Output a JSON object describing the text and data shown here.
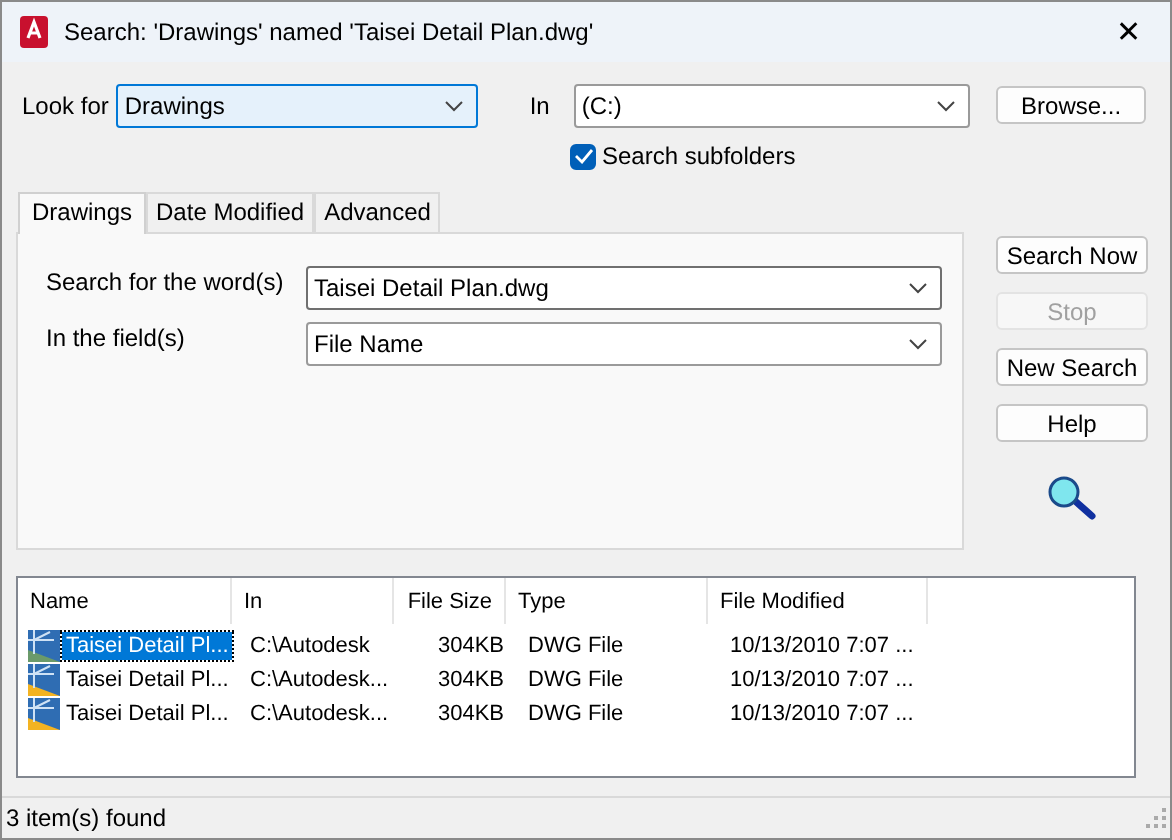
{
  "window": {
    "title": "Search: 'Drawings' named 'Taisei Detail Plan.dwg'",
    "close": "✕"
  },
  "look_for": {
    "label": "Look for",
    "value": "Drawings"
  },
  "in": {
    "label": "In",
    "value": "(C:)"
  },
  "browse_button": "Browse...",
  "search_subfolders": {
    "label": "Search subfolders",
    "checked": true
  },
  "tabs": [
    {
      "label": "Drawings",
      "selected": true
    },
    {
      "label": "Date Modified",
      "selected": false
    },
    {
      "label": "Advanced",
      "selected": false
    }
  ],
  "fields": [
    {
      "label": "Search for the word(s)",
      "value": "Taisei Detail Plan.dwg"
    },
    {
      "label": "In the field(s)",
      "value": "File Name"
    }
  ],
  "buttons": [
    {
      "label": "Search Now",
      "disabled": false
    },
    {
      "label": "Stop",
      "disabled": true
    },
    {
      "label": "New Search",
      "disabled": false
    },
    {
      "label": "Help",
      "disabled": false
    }
  ],
  "results": {
    "columns": [
      "Name",
      "In",
      "File Size",
      "Type",
      "File Modified"
    ],
    "rows": [
      {
        "cells": [
          "Taisei Detail Pl...",
          "C:\\Autodesk",
          "304KB",
          "DWG File",
          "10/13/2010 7:07 ..."
        ],
        "selected": true
      },
      {
        "cells": [
          "Taisei Detail Pl...",
          "C:\\Autodesk...",
          "304KB",
          "DWG File",
          "10/13/2010 7:07 ..."
        ],
        "selected": false
      },
      {
        "cells": [
          "Taisei Detail Pl...",
          "C:\\Autodesk...",
          "304KB",
          "DWG File",
          "10/13/2010 7:07 ..."
        ],
        "selected": false
      }
    ]
  },
  "status_bar": "3 item(s) found"
}
